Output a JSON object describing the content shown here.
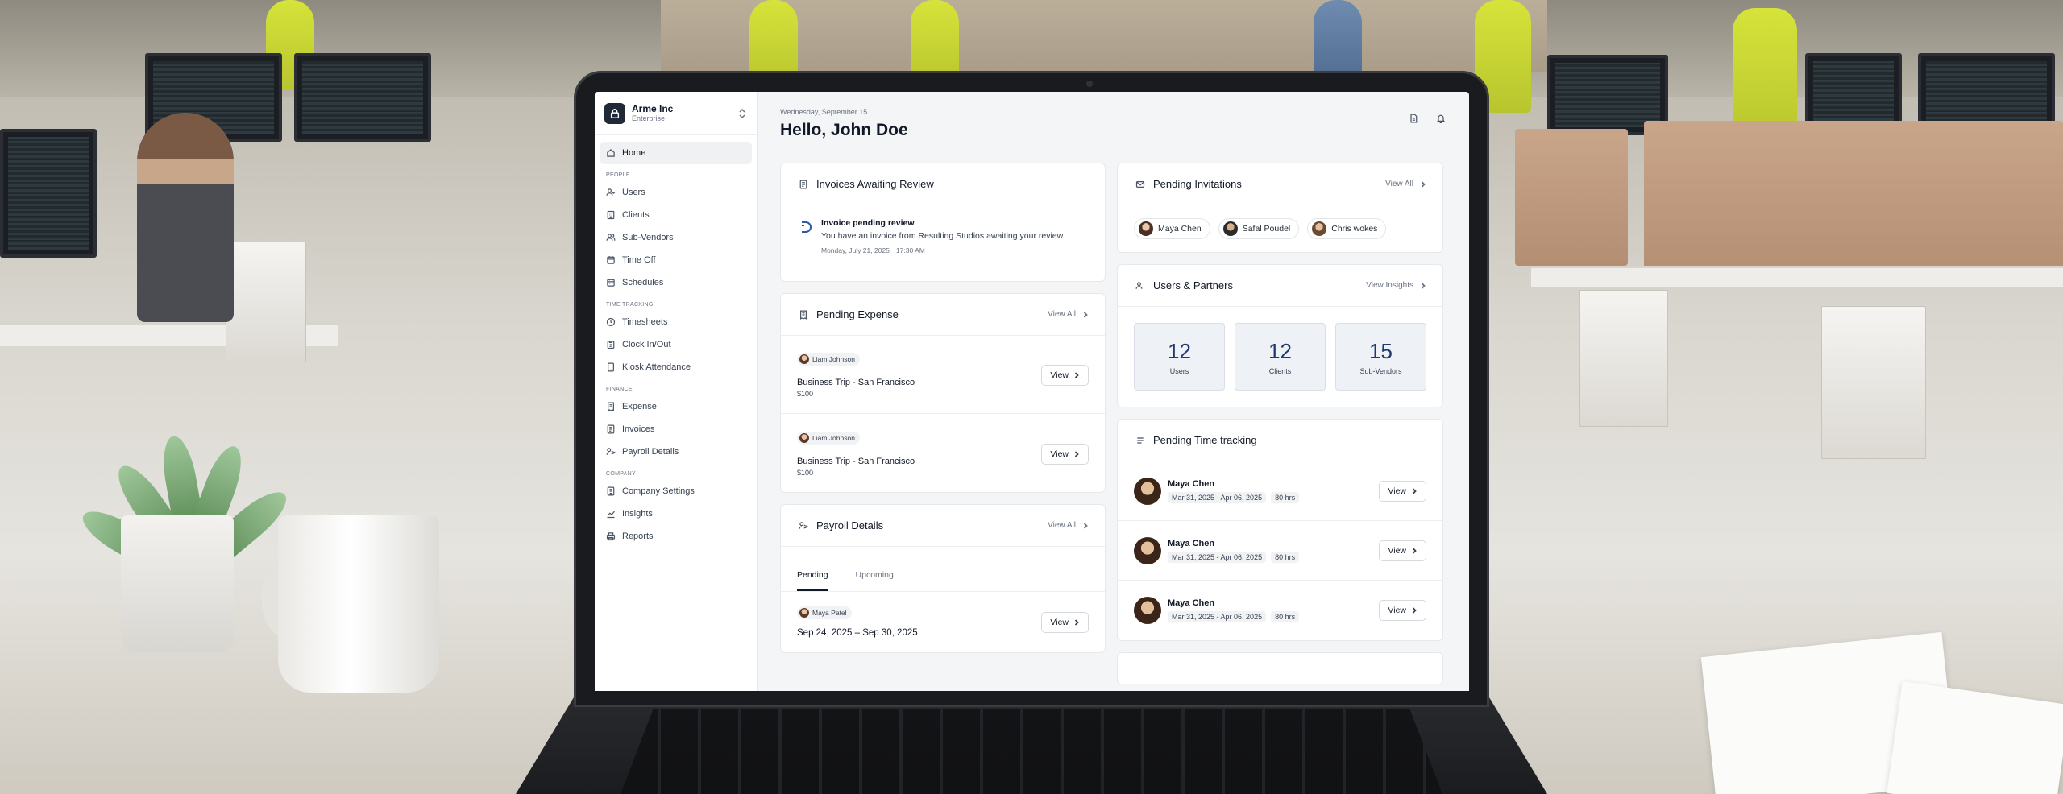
{
  "org": {
    "name": "Arme Inc",
    "plan": "Enterprise"
  },
  "nav": {
    "home": "Home",
    "people_section": "PEOPLE",
    "people": [
      "Users",
      "Clients",
      "Sub-Vendors",
      "Time Off",
      "Schedules"
    ],
    "time_section": "TIME TRACKING",
    "time": [
      "Timesheets",
      "Clock In/Out",
      "Kiosk Attendance"
    ],
    "finance_section": "FINANCE",
    "finance": [
      "Expense",
      "Invoices",
      "Payroll Details"
    ],
    "company_section": "COMPANY",
    "company": [
      "Company Settings",
      "Insights",
      "Reports"
    ]
  },
  "header": {
    "date": "Wednesday, September 15",
    "greeting": "Hello, John Doe"
  },
  "invoices": {
    "title": "Invoices Awaiting Review",
    "item_title": "Invoice pending review",
    "item_desc": "You have an invoice from Resulting Studios awaiting your review.",
    "item_date": "Monday, July 21, 2025",
    "item_time": "17:30 AM"
  },
  "expense": {
    "title": "Pending Expense",
    "view_all": "View All",
    "items": [
      {
        "person": "Liam Johnson",
        "title": "Business Trip - San Francisco",
        "amount": "$100",
        "action": "View"
      },
      {
        "person": "Liam Johnson",
        "title": "Business Trip - San Francisco",
        "amount": "$100",
        "action": "View"
      }
    ]
  },
  "payroll": {
    "title": "Payroll Details",
    "view_all": "View All",
    "tabs": [
      "Pending",
      "Upcoming"
    ],
    "items": [
      {
        "person": "Maya Patel",
        "period": "Sep 24, 2025 – Sep 30, 2025",
        "action": "View"
      }
    ]
  },
  "invitations": {
    "title": "Pending Invitations",
    "view_all": "View All",
    "people": [
      "Maya Chen",
      "Safal Poudel",
      "Chris wokes"
    ]
  },
  "partners": {
    "title": "Users & Partners",
    "view_insights": "View Insights",
    "stats": [
      {
        "value": "12",
        "label": "Users"
      },
      {
        "value": "12",
        "label": "Clients"
      },
      {
        "value": "15",
        "label": "Sub-Vendors"
      }
    ]
  },
  "time_tracking": {
    "title": "Pending Time tracking",
    "items": [
      {
        "name": "Maya Chen",
        "range": "Mar 31, 2025 - Apr 06, 2025",
        "hours": "80 hrs",
        "action": "View"
      },
      {
        "name": "Maya Chen",
        "range": "Mar 31, 2025 - Apr 06, 2025",
        "hours": "80 hrs",
        "action": "View"
      },
      {
        "name": "Maya Chen",
        "range": "Mar 31, 2025 - Apr 06, 2025",
        "hours": "80 hrs",
        "action": "View"
      }
    ]
  },
  "icons": {
    "org_logo": "lock-icon",
    "switch": "chevron-updown-icon",
    "top": [
      "document-icon",
      "bell-icon"
    ]
  },
  "colors": {
    "stat_number": "#1e3a6e",
    "stat_bg": "#eef1f6"
  }
}
